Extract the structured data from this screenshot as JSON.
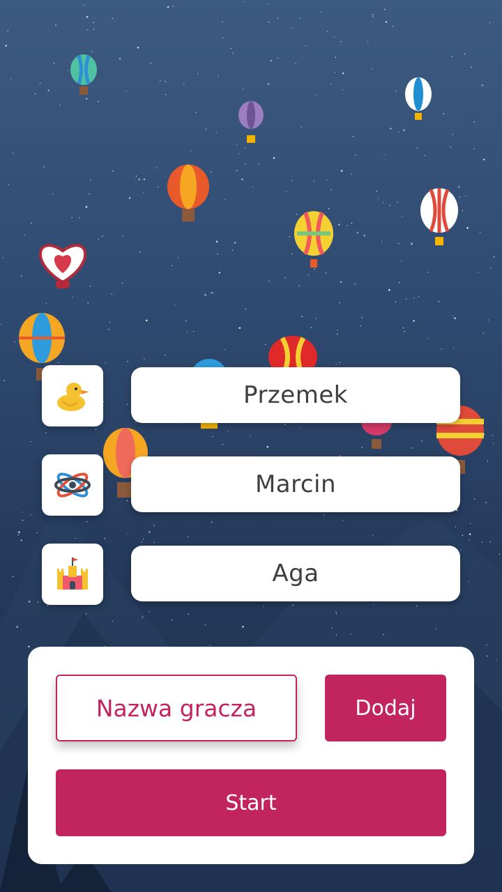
{
  "players": [
    {
      "name": "Przemek",
      "icon": "duck-icon"
    },
    {
      "name": "Marcin",
      "icon": "atom-icon"
    },
    {
      "name": "Aga",
      "icon": "castle-icon"
    }
  ],
  "form": {
    "name_placeholder": "Nazwa gracza",
    "name_value": "",
    "add_label": "Dodaj",
    "start_label": "Start"
  },
  "colors": {
    "accent": "#c2245e",
    "sky_top": "#3d5a80",
    "sky_bottom": "#1c2d47"
  }
}
